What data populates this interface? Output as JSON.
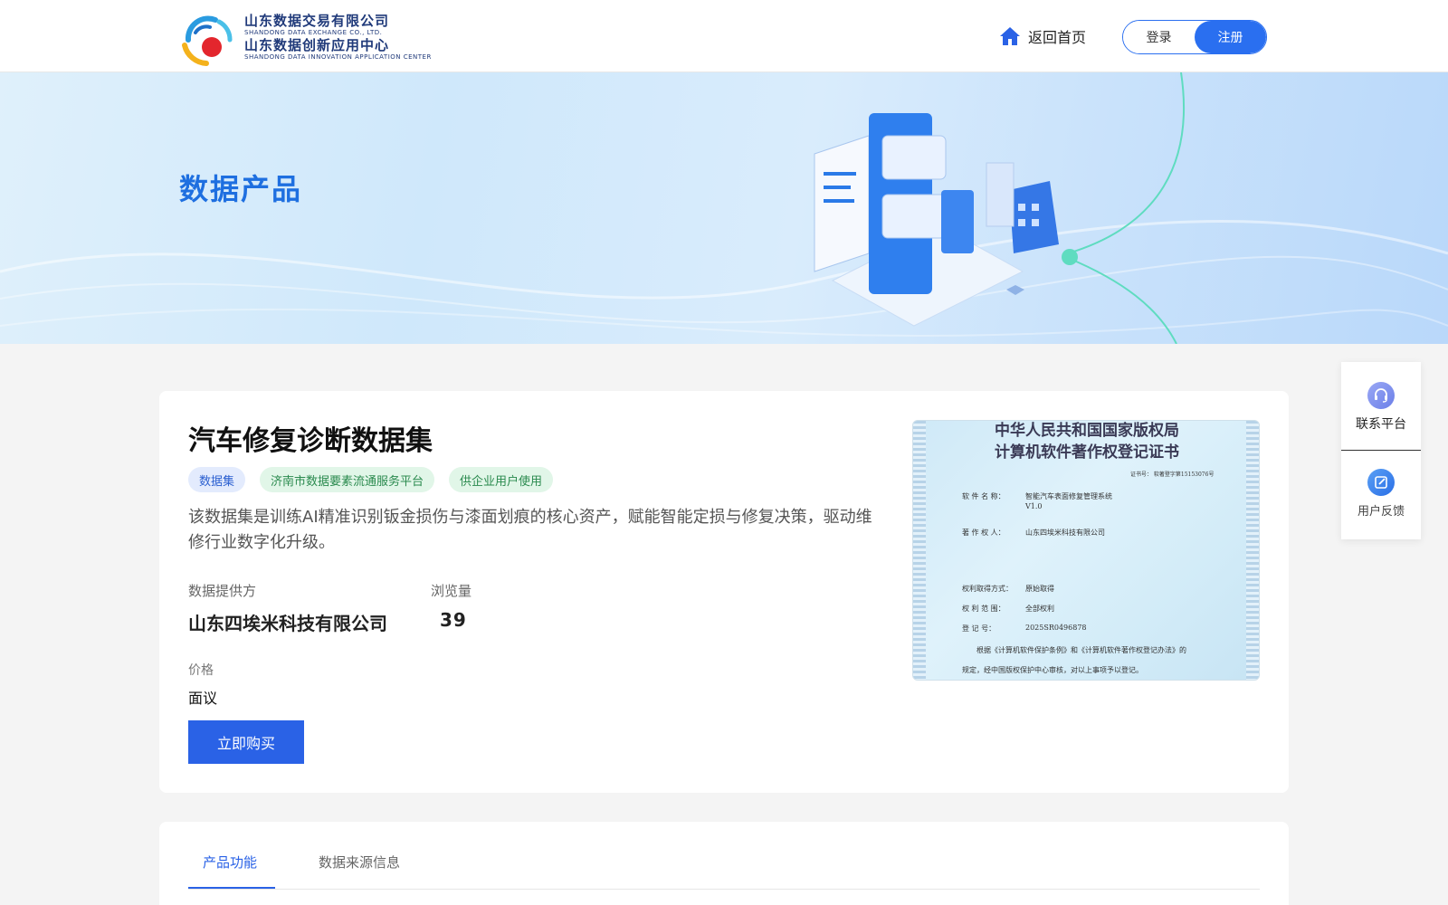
{
  "header": {
    "logo": {
      "line1_cn": "山东数据交易有限公司",
      "line1_en": "SHANDONG DATA EXCHANGE CO., LTD.",
      "line2_cn": "山东数据创新应用中心",
      "line2_en": "SHANDONG DATA INNOVATION APPLICATION CENTER"
    },
    "home_label": "返回首页",
    "home_icon": "home-icon",
    "login_label": "登录",
    "register_label": "注册"
  },
  "banner": {
    "title": "数据产品"
  },
  "product": {
    "title": "汽车修复诊断数据集",
    "tags": [
      "数据集",
      "济南市数据要素流通服务平台",
      "供企业用户使用"
    ],
    "description": "该数据集是训练AI精准识别钣金损伤与漆面划痕的核心资产，赋能智能定损与修复决策，驱动维修行业数字化升级。",
    "provider_label": "数据提供方",
    "provider_value": "山东四埃米科技有限公司",
    "views_label": "浏览量",
    "views_value": "39",
    "price_label": "价格",
    "price_value": "面议",
    "buy_label": "立即购买"
  },
  "certificate": {
    "heading1": "中华人民共和国国家版权局",
    "heading2": "计算机软件著作权登记证书",
    "cert_no": "证书号： 软著登字第15153076号",
    "software_name_label": "软 件 名 称：",
    "software_name_value": "智能汽车表面修复管理系统",
    "version": "V1.0",
    "owner_label": "著 作 权 人：",
    "owner_value": "山东四埃米科技有限公司",
    "acquire_label": "权利取得方式：",
    "acquire_value": "原始取得",
    "scope_label": "权 利 范 围：",
    "scope_value": "全部权利",
    "reg_label": "登 记 号：",
    "reg_value": "2025SR0496878",
    "footer1": "根据《计算机软件保护条例》和《计算机软件著作权登记办法》的",
    "footer2": "规定，经中国版权保护中心审核，对以上事项予以登记。"
  },
  "tabs": [
    "产品功能",
    "数据来源信息"
  ],
  "side_panel": {
    "contact_label": "联系平台",
    "contact_icon": "headset-icon",
    "feedback_label": "用户反馈",
    "feedback_icon": "edit-icon"
  },
  "colors": {
    "accent": "#2a62e6",
    "banner_title": "#1e6fe0"
  }
}
